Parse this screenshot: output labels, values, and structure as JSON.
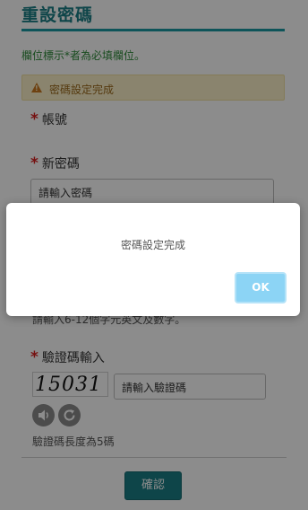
{
  "page": {
    "title": "重設密碼",
    "required_note": "欄位標示*者為必填欄位。",
    "alert": {
      "text": "密碼設定完成",
      "icon": "warning-icon"
    },
    "account_label": "帳號",
    "new_password_label": "新密碼",
    "new_password_placeholder": "請輸入密碼",
    "password_hint": "請輸入6-12個字元英文及數字。",
    "captcha_label": "驗證碼輸入",
    "captcha_code": "15031",
    "captcha_placeholder": "請輸入驗證碼",
    "captcha_hint": "驗證碼長度為5碼",
    "audio_icon": "speaker-icon",
    "refresh_icon": "refresh-icon",
    "confirm_label": "確認",
    "required_mark": "*"
  },
  "dialog": {
    "message": "密碼設定完成",
    "ok_label": "OK"
  },
  "colors": {
    "accent": "#1a7f86",
    "alert_bg": "#fcf0c8",
    "required": "#d82020",
    "ok_button": "#8cd4f5"
  }
}
